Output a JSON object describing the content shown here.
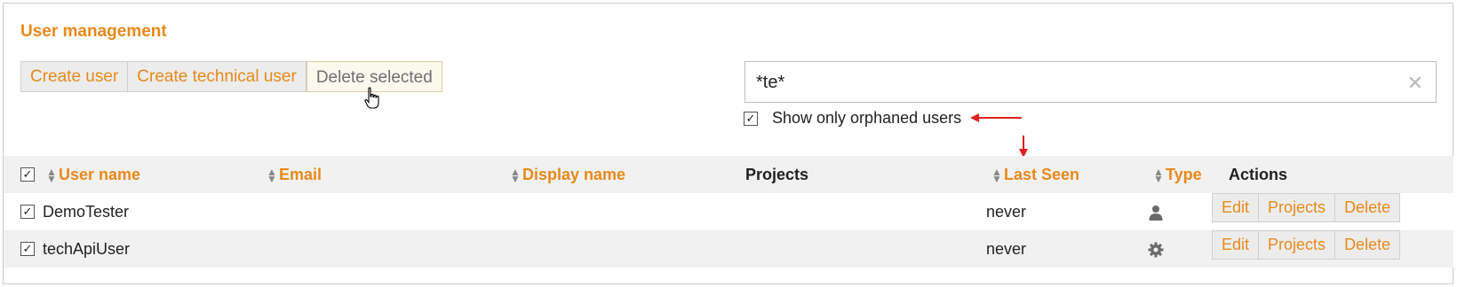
{
  "page": {
    "title": "User management"
  },
  "toolbar": {
    "create_user": "Create user",
    "create_technical_user": "Create technical user",
    "delete_selected": "Delete selected"
  },
  "search": {
    "value": "*te*",
    "clear_icon": "close-icon"
  },
  "filter": {
    "orphaned_label": "Show only orphaned users",
    "orphaned_checked": true
  },
  "table": {
    "headers": {
      "user_name": "User name",
      "email": "Email",
      "display_name": "Display name",
      "projects": "Projects",
      "last_seen": "Last Seen",
      "type": "Type",
      "actions": "Actions"
    },
    "rows": [
      {
        "user_name": "DemoTester",
        "email": "",
        "display_name": "",
        "projects": "",
        "last_seen": "never",
        "type_icon": "person-icon",
        "checked": true
      },
      {
        "user_name": "techApiUser",
        "email": "",
        "display_name": "",
        "projects": "",
        "last_seen": "never",
        "type_icon": "gear-icon",
        "checked": true
      }
    ],
    "row_actions": {
      "edit": "Edit",
      "projects": "Projects",
      "delete": "Delete"
    }
  },
  "colors": {
    "accent": "#e8891a",
    "annotation": "#e02020"
  }
}
